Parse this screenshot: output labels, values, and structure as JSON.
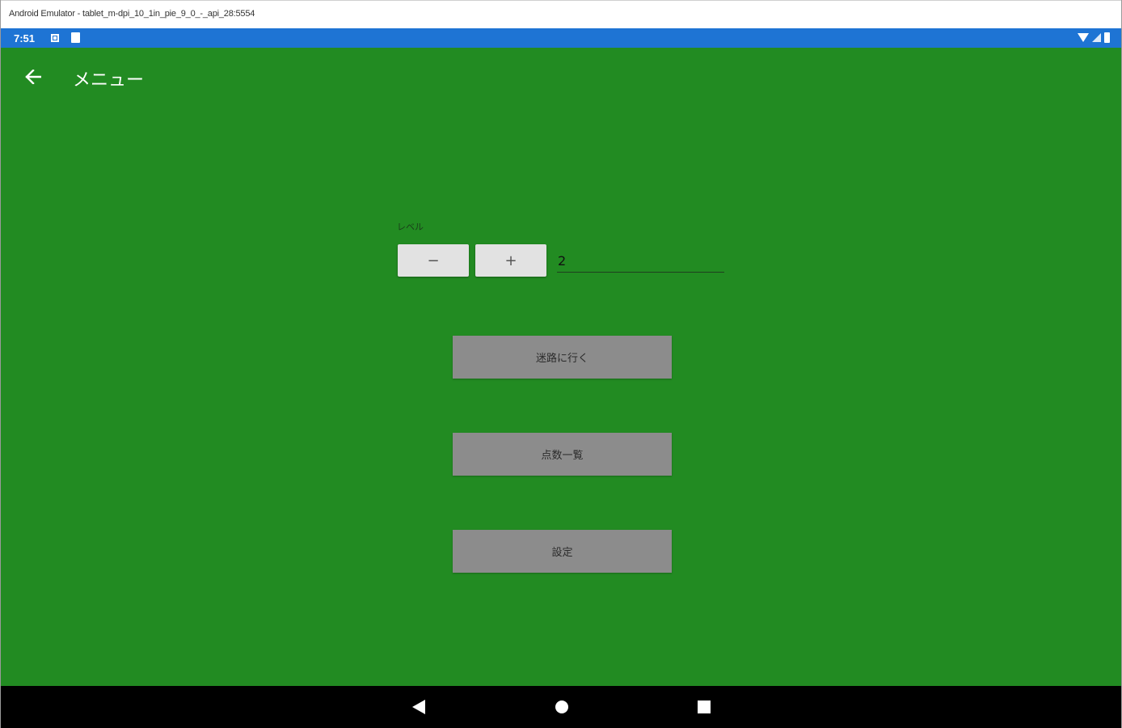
{
  "window": {
    "title": "Android Emulator - tablet_m-dpi_10_1in_pie_9_0_-_api_28:5554"
  },
  "status_bar": {
    "time": "7:51",
    "left_icons": [
      "notification-icon",
      "sd-card-icon"
    ],
    "right_icons": [
      "wifi-icon",
      "cell-signal-icon",
      "battery-icon"
    ]
  },
  "toolbar": {
    "back_icon": "arrow-left-icon",
    "title": "メニュー"
  },
  "level": {
    "label": "レベル",
    "minus_label": "−",
    "plus_label": "+",
    "value": "2"
  },
  "menu": {
    "maze_label": "迷路に行く",
    "scores_label": "点数一覧",
    "settings_label": "設定"
  },
  "navigation_bar": {
    "icons": [
      "nav-back-icon",
      "nav-home-icon",
      "nav-recents-icon"
    ]
  },
  "colors": {
    "status_bar": "#1e74d4",
    "app_background": "#228b22",
    "stepper_button": "#e2e2e2",
    "menu_button": "#8c8c8c",
    "navigation_bar": "#000000"
  }
}
